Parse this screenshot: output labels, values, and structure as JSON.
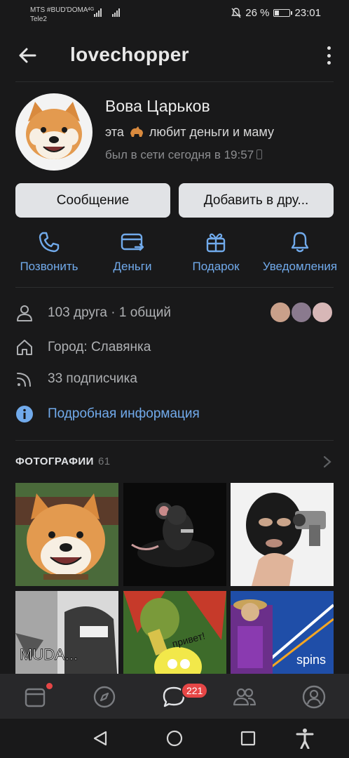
{
  "status_bar": {
    "carrier1": "MTS #BUD'DOMA",
    "carrier2": "Tele2",
    "net": "4G",
    "battery": "26 %",
    "time": "23:01"
  },
  "header": {
    "title": "lovechopper"
  },
  "profile": {
    "name": "Вова Царьков",
    "status_before": "эта",
    "status_after": "любит деньги и маму",
    "last_seen": "был в сети сегодня в 19:57",
    "message_button": "Сообщение",
    "add_friend_button": "Добавить в дру..."
  },
  "actions": [
    {
      "label": "Позвонить",
      "icon": "phone-icon"
    },
    {
      "label": "Деньги",
      "icon": "money-icon"
    },
    {
      "label": "Подарок",
      "icon": "gift-icon"
    },
    {
      "label": "Уведомления",
      "icon": "bell-icon"
    }
  ],
  "info": {
    "friends": "103 друга · 1 общий",
    "city": "Город: Славянка",
    "followers": "33 подписчика",
    "details": "Подробная информация"
  },
  "photos": {
    "title": "ФОТОГРАФИИ",
    "count": "61",
    "muda": "MUDA...",
    "privet": "привет!",
    "spins": "spins"
  },
  "tabbar": {
    "badge": "221"
  },
  "colors": {
    "accent": "#71aaeb",
    "background": "#19191a",
    "badge": "#e64646"
  }
}
